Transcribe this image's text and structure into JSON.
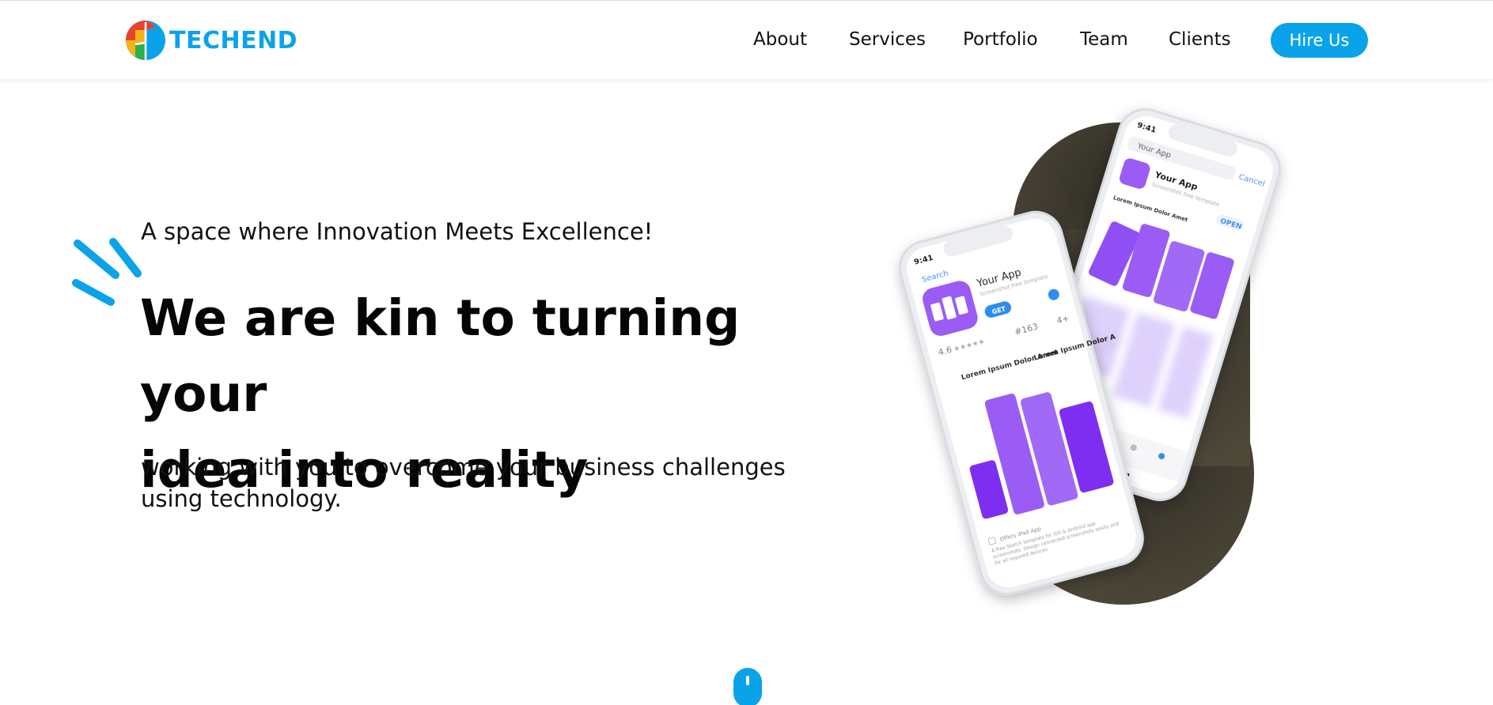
{
  "brand": {
    "name": "TECHEND",
    "color": "#0aa3ea",
    "logo_colors": [
      "#e8432d",
      "#f5b31a",
      "#2fae4a",
      "#0aa3ea"
    ]
  },
  "nav": {
    "items": [
      "About",
      "Services",
      "Portfolio",
      "Team",
      "Clients"
    ],
    "cta_label": "Hire Us"
  },
  "hero": {
    "tagline": "A space where Innovation Meets Excellence!",
    "headline_line1": "We are kin to turning your",
    "headline_line2": "idea into reality",
    "subtext_line1": "working with you to overcome your business challenges",
    "subtext_line2": "using technology."
  },
  "illustration": {
    "front_phone": {
      "time": "9:41",
      "back_label": "Search",
      "app_name": "Your App",
      "app_subtitle": "Screenshot free template",
      "get_label": "GET",
      "rating": "4.6",
      "rating_count": "#163",
      "age": "4+",
      "card_title": "Lorem Ipsum Dolor Amet",
      "card_title_b": "Lorem Ipsum Dolor A",
      "ipad_label": "Offers iPad App",
      "footer_text": "A free Sketch template for iOS & Android app screenshots. Design connected screenshots easily and for all required devices."
    },
    "back_phone": {
      "time": "9:41",
      "search_text": "Your App",
      "cancel_label": "Cancel",
      "app_name": "Your App",
      "app_subtitle": "Screenshot free template",
      "open_label": "OPEN",
      "card_title": "Lorem Ipsum Dolor Amet"
    },
    "accent": "#9a5cf5",
    "blob": "#4a4535"
  }
}
